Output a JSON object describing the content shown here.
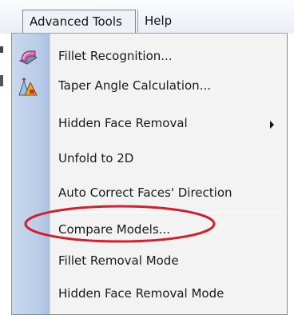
{
  "menubar": {
    "advanced_tools": "Advanced Tools",
    "help": "Help"
  },
  "menu": {
    "items": [
      {
        "label": "Fillet Recognition...",
        "icon": "fillet-recognition-icon"
      },
      {
        "label": "Taper Angle Calculation...",
        "icon": "taper-angle-icon"
      },
      {
        "label": "Hidden Face Removal",
        "submenu": true
      },
      {
        "label": "Unfold to 2D"
      },
      {
        "label": "Auto Correct Faces' Direction"
      },
      {
        "label": "Compare Models...",
        "highlighted_annotation": true
      },
      {
        "label": "Fillet Removal Mode"
      },
      {
        "label": "Hidden Face Removal Mode"
      }
    ]
  },
  "colors": {
    "gutter": "#b9cde8",
    "annotation": "#d21f2a",
    "panel": "#f3f3f3"
  }
}
